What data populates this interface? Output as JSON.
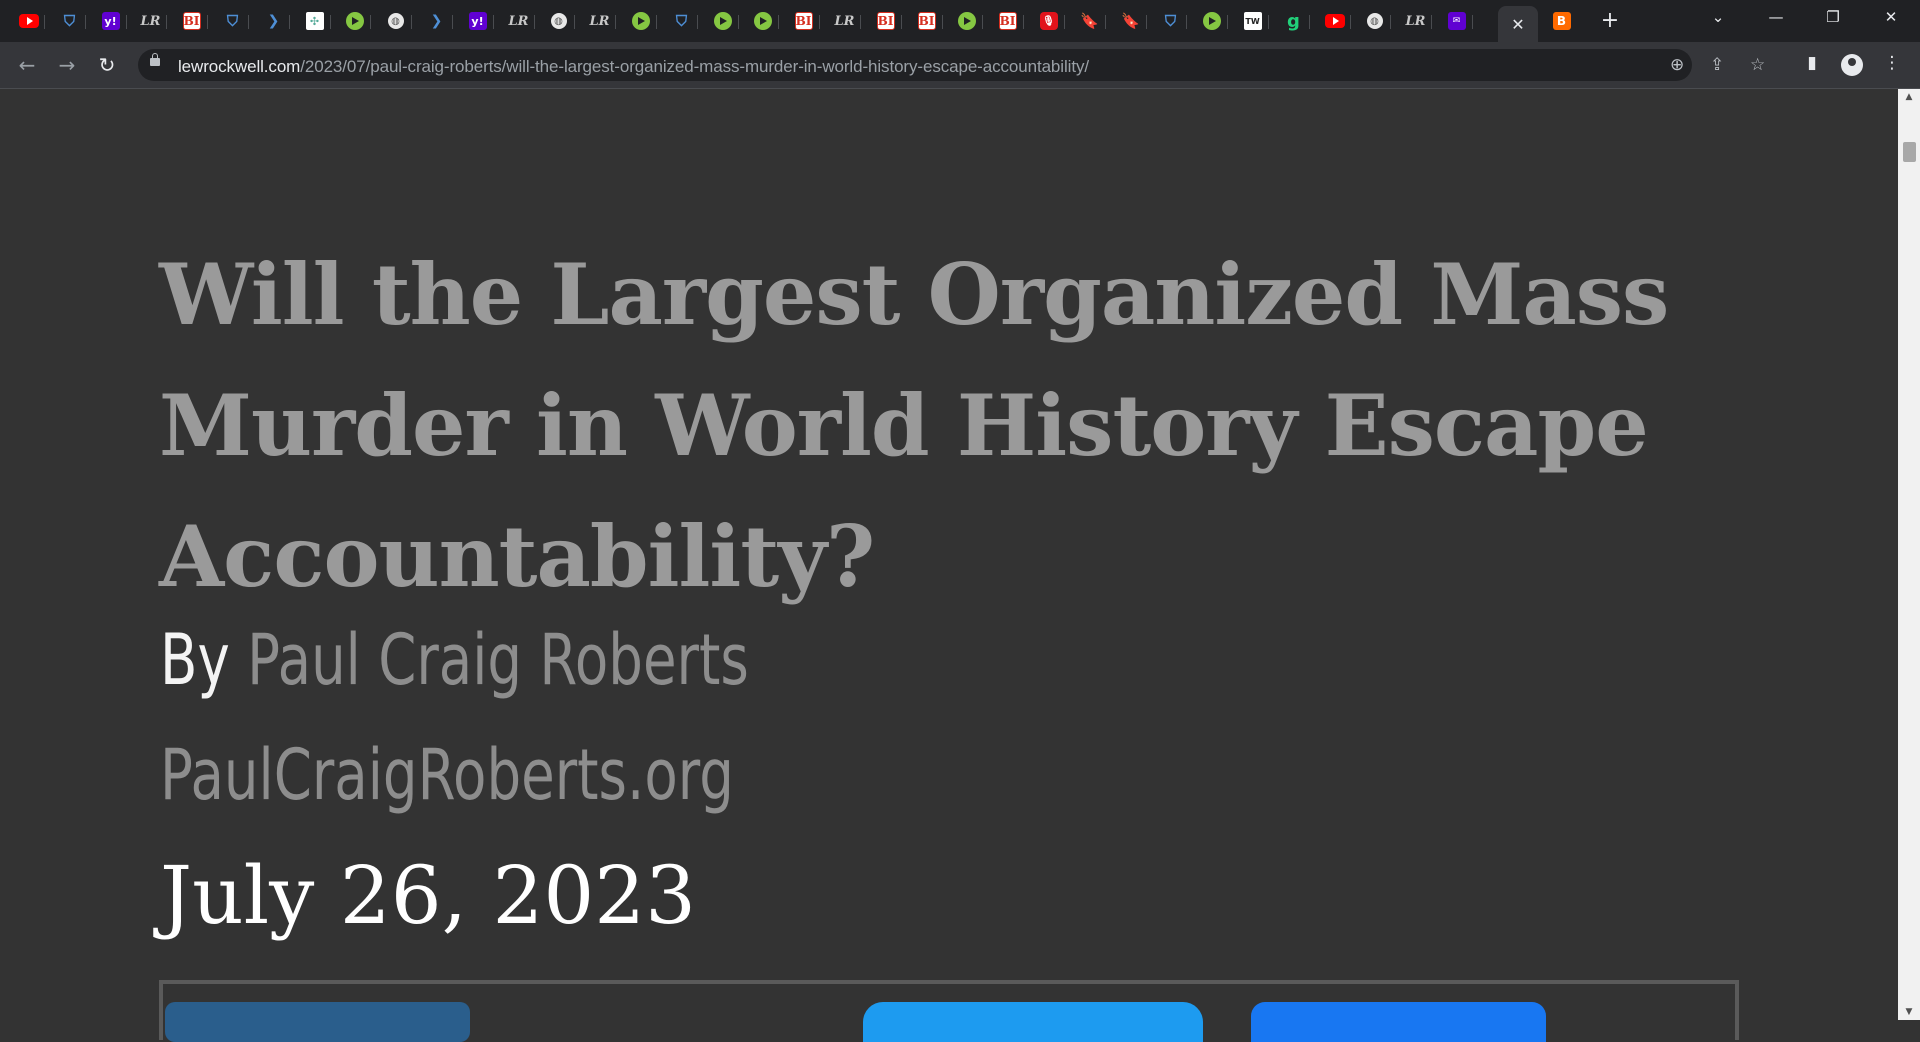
{
  "browser": {
    "tabs": [
      {
        "icon": "youtube-icon",
        "glyph": "",
        "cls": "yt"
      },
      {
        "icon": "shield-icon",
        "glyph": "⛉",
        "cls": "shield"
      },
      {
        "icon": "yahoo-icon",
        "glyph": "y!",
        "cls": "yahoo"
      },
      {
        "icon": "lewrockwell-icon",
        "glyph": "LR",
        "cls": "lr"
      },
      {
        "icon": "business-insider-icon",
        "glyph": "BI",
        "cls": "bi"
      },
      {
        "icon": "shield-icon",
        "glyph": "⛉",
        "cls": "shield"
      },
      {
        "icon": "arrow-icon",
        "glyph": "❯",
        "cls": "arrow"
      },
      {
        "icon": "puzzle-icon",
        "glyph": "✣",
        "cls": "puzzle"
      },
      {
        "icon": "rumble-icon",
        "glyph": "",
        "cls": "rumble"
      },
      {
        "icon": "globe-icon",
        "glyph": "◍",
        "cls": "globe"
      },
      {
        "icon": "arrow-icon",
        "glyph": "❯",
        "cls": "arrow"
      },
      {
        "icon": "yahoo-icon",
        "glyph": "y!",
        "cls": "yahoo"
      },
      {
        "icon": "lewrockwell-icon",
        "glyph": "LR",
        "cls": "lr"
      },
      {
        "icon": "globe-icon",
        "glyph": "◍",
        "cls": "globe"
      },
      {
        "icon": "lewrockwell-icon",
        "glyph": "LR",
        "cls": "lr"
      },
      {
        "icon": "rumble-icon",
        "glyph": "",
        "cls": "rumble"
      },
      {
        "icon": "shield-icon",
        "glyph": "⛉",
        "cls": "shield"
      },
      {
        "icon": "rumble-icon",
        "glyph": "",
        "cls": "rumble"
      },
      {
        "icon": "rumble-icon",
        "glyph": "",
        "cls": "rumble"
      },
      {
        "icon": "business-insider-icon",
        "glyph": "BI",
        "cls": "bi"
      },
      {
        "icon": "lewrockwell-icon",
        "glyph": "LR",
        "cls": "lr"
      },
      {
        "icon": "business-insider-icon",
        "glyph": "BI",
        "cls": "bi"
      },
      {
        "icon": "business-insider-icon",
        "glyph": "BI",
        "cls": "bi"
      },
      {
        "icon": "rumble-icon",
        "glyph": "",
        "cls": "rumble"
      },
      {
        "icon": "business-insider-icon",
        "glyph": "BI",
        "cls": "bi"
      },
      {
        "icon": "microphone-icon",
        "glyph": "🎙",
        "cls": "mic"
      },
      {
        "icon": "bookmark-icon",
        "glyph": "🔖",
        "cls": "book"
      },
      {
        "icon": "bookmark-icon",
        "glyph": "🔖",
        "cls": "book"
      },
      {
        "icon": "shield-icon",
        "glyph": "⛉",
        "cls": "shield"
      },
      {
        "icon": "rumble-icon",
        "glyph": "",
        "cls": "rumble"
      },
      {
        "icon": "twitter-icon",
        "glyph": "TW",
        "cls": "tw"
      },
      {
        "icon": "g-icon",
        "glyph": "g",
        "cls": "g"
      },
      {
        "icon": "youtube-icon",
        "glyph": "",
        "cls": "yt"
      },
      {
        "icon": "globe-icon",
        "glyph": "◍",
        "cls": "globe"
      },
      {
        "icon": "lewrockwell-icon",
        "glyph": "LR",
        "cls": "lr"
      },
      {
        "icon": "yahoo-mail-icon",
        "glyph": "✉",
        "cls": "mail"
      }
    ],
    "active_tab_close": "✕",
    "after_tab": {
      "icon": "brave-icon",
      "glyph": "B",
      "cls": "brave"
    },
    "new_tab": "+",
    "window_controls": {
      "tab_search": "⌄",
      "minimize": "—",
      "restore": "❐",
      "close": "✕"
    },
    "nav": {
      "back": "←",
      "forward": "→",
      "reload": "↻"
    },
    "url_host": "lewrockwell.com",
    "url_path": "/2023/07/paul-craig-roberts/will-the-largest-organized-mass-murder-in-world-history-escape-accountability/",
    "omnibox_icons": {
      "zoom": "⊕",
      "share": "⇪",
      "star": "☆"
    },
    "toolbar_icons": {
      "sidepanel": "▮",
      "menu": "⋮"
    }
  },
  "article": {
    "title": "Will the Largest Organized Mass Murder in World History Escape Accountability?",
    "by_label": "By",
    "author": "Paul Craig Roberts",
    "source": "PaulCraigRoberts.org",
    "date": "July 26, 2023"
  },
  "share_colors": {
    "first": "#2a5e8c",
    "second": "#1d9bf0",
    "third": "#1877f2"
  },
  "scrollbar": {
    "up": "▲",
    "down": "▼"
  }
}
